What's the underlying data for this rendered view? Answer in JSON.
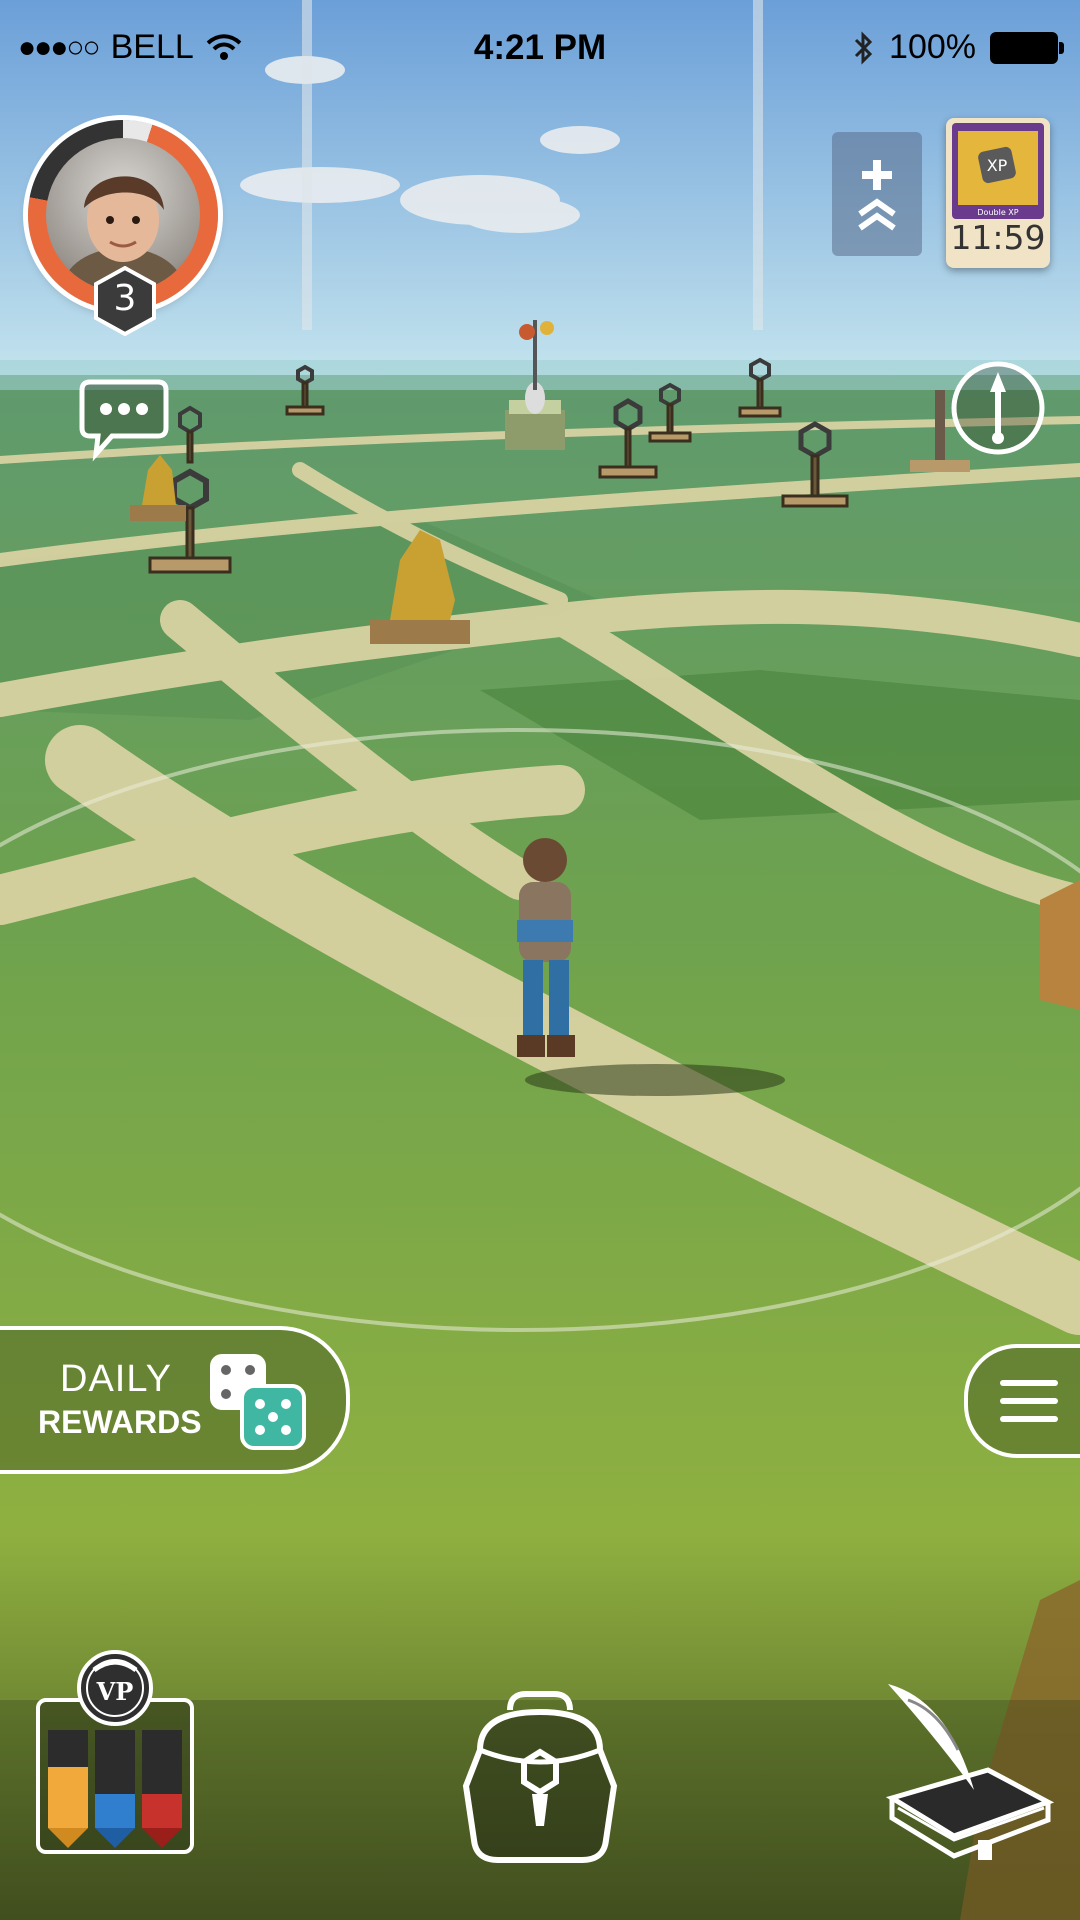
{
  "status_bar": {
    "signal_dots": "●●●○○",
    "carrier": "BELL",
    "wifi_icon": "wifi-icon",
    "time": "4:21 PM",
    "bluetooth_icon": "bluetooth-icon",
    "battery_percent": "100%",
    "battery_level": 1.0
  },
  "player": {
    "level": "3",
    "xp_progress": 0.78
  },
  "chat": {
    "icon": "chat-bubble-icon"
  },
  "buff": {
    "icon": "plus-chevrons-icon",
    "card_title": "Double XP",
    "card_timer": "11:59"
  },
  "compass": {
    "icon": "compass-icon"
  },
  "daily_rewards": {
    "line1": "DAILY",
    "line2": "REWARDS",
    "icon": "dice-icon"
  },
  "menu": {
    "icon": "hamburger-menu-icon"
  },
  "bottom_bar": {
    "vp_badge": "VP",
    "vp_bars": [
      {
        "color": "#f2a93b",
        "level": 0.62
      },
      {
        "color": "#2f7fce",
        "level": 0.35
      },
      {
        "color": "#c8322d",
        "level": 0.35
      }
    ],
    "backpack_icon": "backpack-icon",
    "journal_icon": "quill-book-icon"
  },
  "colors": {
    "sky_top": "#6b9fd8",
    "sky_bottom": "#bfe0ec",
    "grass": "#7fa848",
    "path": "#d9d3a6",
    "ring_accent": "#e86a3c"
  }
}
